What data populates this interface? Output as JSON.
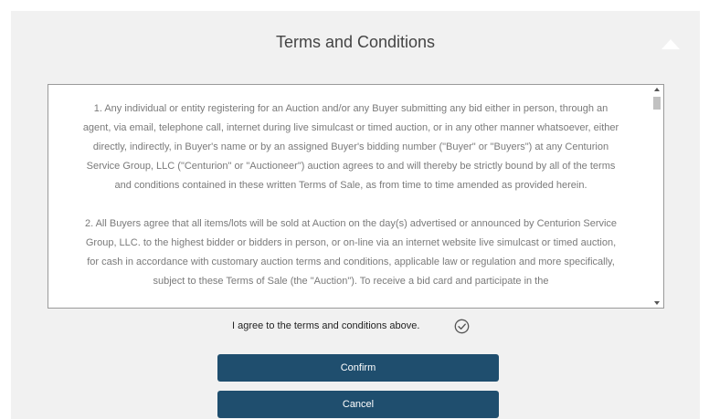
{
  "dialog": {
    "title": "Terms and Conditions",
    "collapse_icon": "triangle-up-icon"
  },
  "terms": {
    "paragraphs": [
      "1. Any individual or entity registering for an Auction and/or any Buyer submitting any bid either in person, through an agent, via email, telephone call, internet during live simulcast or timed auction, or in any other manner whatsoever, either directly, indirectly, in Buyer's name or by an assigned Buyer's bidding number (\"Buyer\" or \"Buyers\") at any Centurion Service Group, LLC (\"Centurion\" or \"Auctioneer\") auction agrees to and will thereby be strictly bound by all of the terms and conditions contained in these written Terms of Sale, as from time to time amended as provided herein.",
      "2. All Buyers agree that all items/lots will be sold at Auction on the day(s) advertised or announced by Centurion Service Group, LLC. to the highest bidder or bidders in person, or on-line via an internet website live simulcast or timed auction, for cash in accordance with customary auction terms and conditions, applicable law or regulation and more specifically, subject to these Terms of Sale (the \"Auction\"). To receive a bid card and participate in the"
    ]
  },
  "agree": {
    "label": "I agree to the terms and conditions above.",
    "check_icon": "check-circle-icon",
    "checked": true
  },
  "buttons": {
    "confirm_label": "Confirm",
    "cancel_label": "Cancel"
  },
  "colors": {
    "panel_bg": "#f1f1f1",
    "button_bg": "#1f4e6e",
    "body_text": "#7a7a7a"
  }
}
